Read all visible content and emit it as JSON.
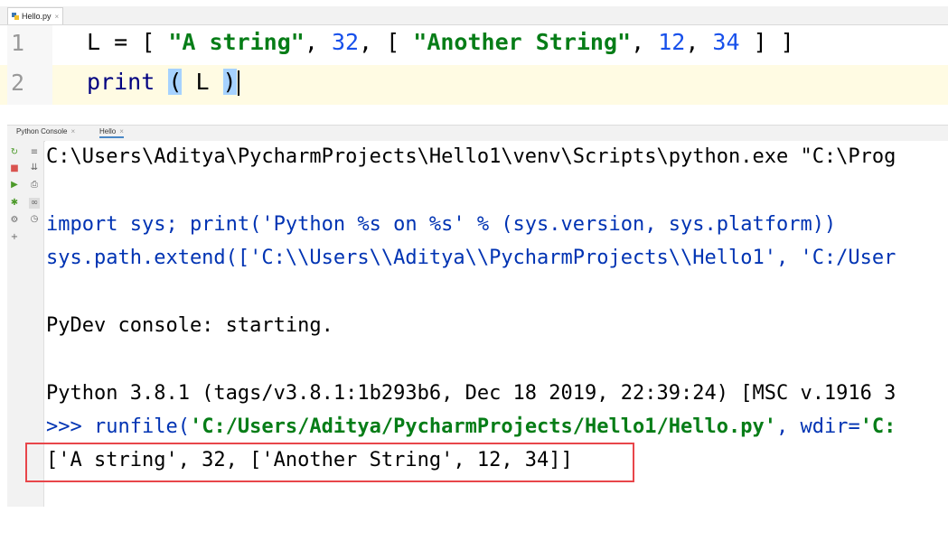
{
  "editor": {
    "tab_label": "Hello.py",
    "tab_close": "×",
    "lines": [
      {
        "number": "1",
        "text": "L = [ \"A string\", 32, [ \"Another String\", 12, 34 ] ]"
      },
      {
        "number": "2",
        "text": "print ( L )"
      }
    ],
    "line1_tokens": {
      "pre": "L = [ ",
      "s1": "\"A string\"",
      "c1": ", ",
      "n1": "32",
      "c2": ", [ ",
      "s2": "\"Another String\"",
      "c3": ", ",
      "n2": "12",
      "c4": ", ",
      "n3": "34",
      "post": " ] ]"
    },
    "line2_tokens": {
      "kw": "print",
      "sp": " ",
      "open": "(",
      "mid": " L ",
      "close": ")"
    }
  },
  "tool_tabs": [
    {
      "label": "Python Console",
      "close": "×"
    },
    {
      "label": "Hello",
      "close": "×"
    }
  ],
  "side_icons": [
    {
      "name": "rerun-icon",
      "glyph": "↻",
      "color": "#4c9a2a"
    },
    {
      "name": "stop-icon",
      "glyph": "■",
      "color": "#d9534f"
    },
    {
      "name": "run-icon",
      "glyph": "▶",
      "color": "#4c9a2a"
    },
    {
      "name": "debug-icon",
      "glyph": "✱",
      "color": "#4c9a2a"
    },
    {
      "name": "settings-icon",
      "glyph": "⚙",
      "color": "#666666"
    },
    {
      "name": "add-icon",
      "glyph": "+",
      "color": "#666666"
    },
    {
      "name": "soft-wrap-icon",
      "glyph": "≡",
      "color": "#666666"
    },
    {
      "name": "scroll-end-icon",
      "glyph": "⇊",
      "color": "#666666"
    },
    {
      "name": "print-icon",
      "glyph": "⎙",
      "color": "#666666"
    },
    {
      "name": "variables-icon",
      "glyph": "∞",
      "color": "#666666"
    },
    {
      "name": "history-icon",
      "glyph": "◷",
      "color": "#666666"
    }
  ],
  "console": {
    "line1": "C:\\Users\\Aditya\\PycharmProjects\\Hello1\\venv\\Scripts\\python.exe \"C:\\Prog",
    "line2": "import sys; print('Python %s on %s' % (sys.version, sys.platform))",
    "line3": "sys.path.extend(['C:\\\\Users\\\\Aditya\\\\PycharmProjects\\\\Hello1', 'C:/User",
    "line4": "PyDev console: starting.",
    "line5": "Python 3.8.1 (tags/v3.8.1:1b293b6, Dec 18 2019, 22:39:24) [MSC v.1916 3",
    "runfile_prompt": ">>> ",
    "runfile_call": "runfile(",
    "runfile_path": "'C:/Users/Aditya/PycharmProjects/Hello1/Hello.py'",
    "runfile_mid": ", wdir=",
    "runfile_wdir": "'C:",
    "result": "['A string', 32, ['Another String', 12, 34]]"
  }
}
